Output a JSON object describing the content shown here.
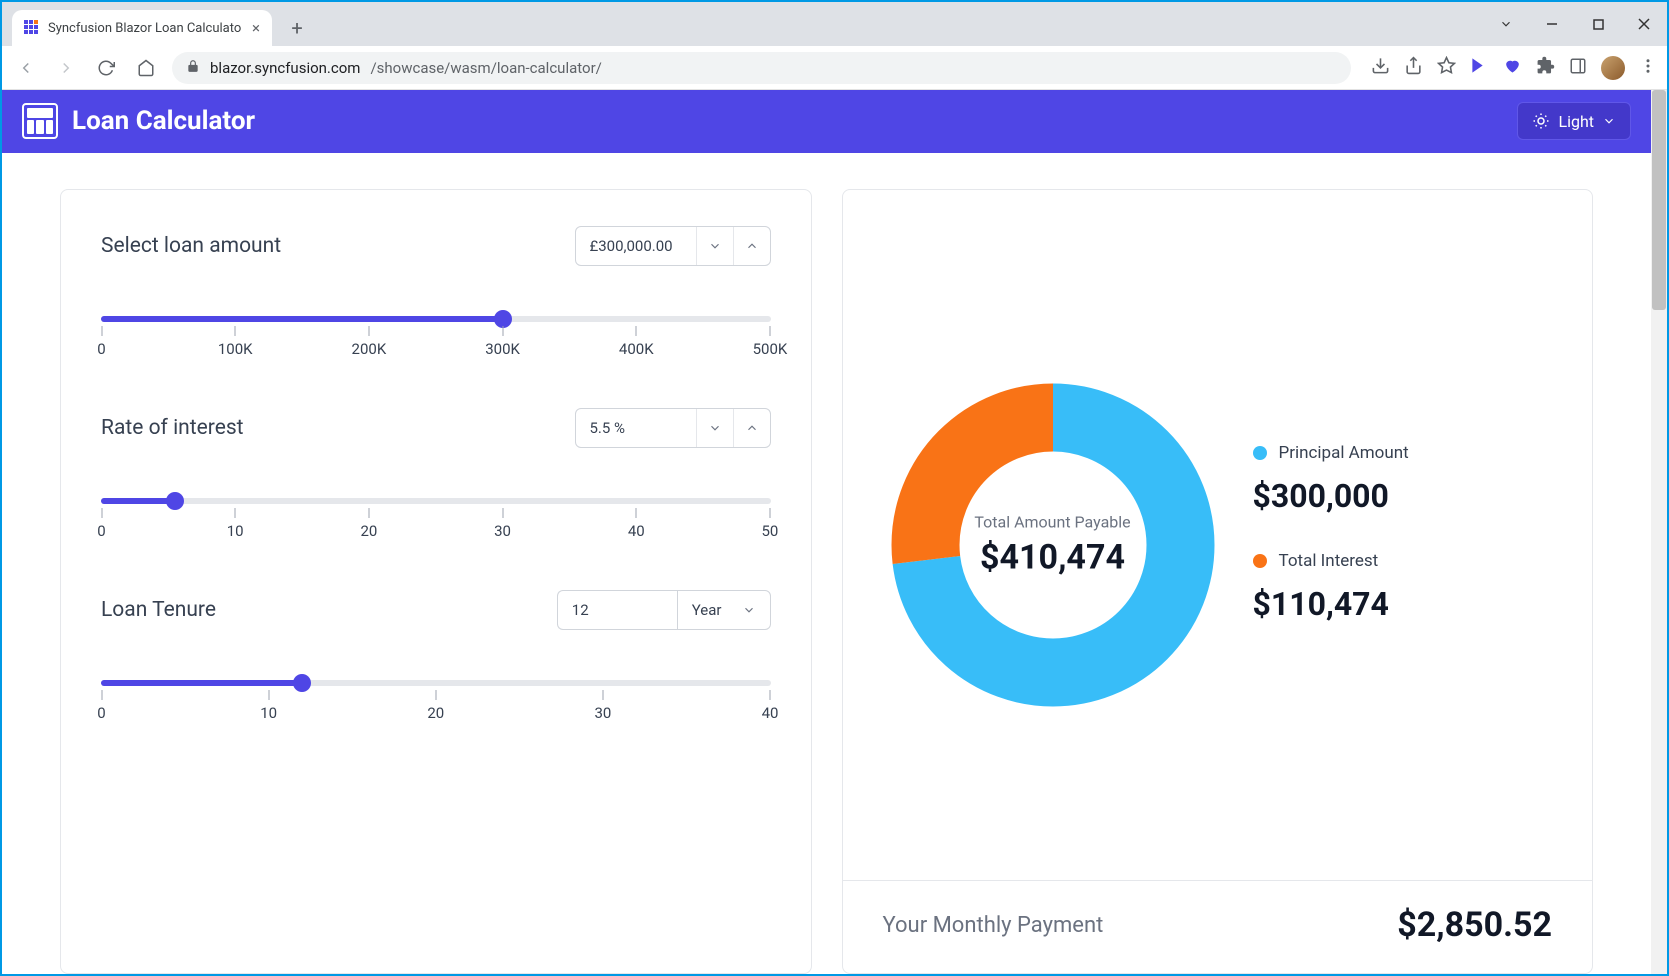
{
  "browser": {
    "tab_title": "Syncfusion Blazor Loan Calculato",
    "url_host": "blazor.syncfusion.com",
    "url_path": "/showcase/wasm/loan-calculator/"
  },
  "header": {
    "title": "Loan Calculator",
    "theme_label": "Light"
  },
  "inputs": {
    "amount": {
      "label": "Select loan amount",
      "value": "£300,000.00",
      "percent": 60,
      "ticks": [
        "0",
        "100K",
        "200K",
        "300K",
        "400K",
        "500K"
      ]
    },
    "rate": {
      "label": "Rate of interest",
      "value": "5.5  %",
      "percent": 11,
      "ticks": [
        "0",
        "10",
        "20",
        "30",
        "40",
        "50"
      ]
    },
    "tenure": {
      "label": "Loan Tenure",
      "value": "12",
      "unit": "Year",
      "percent": 30,
      "ticks": [
        "0",
        "10",
        "20",
        "30",
        "40"
      ]
    }
  },
  "results": {
    "center_label": "Total Amount Payable",
    "center_value": "$410,474",
    "principal_label": "Principal Amount",
    "principal_value": "$300,000",
    "interest_label": "Total Interest",
    "interest_value": "$110,474",
    "monthly_label": "Your Monthly Payment",
    "monthly_value": "$2,850.52"
  },
  "colors": {
    "principal": "#38bdf8",
    "interest": "#f97316",
    "accent": "#4f46e5"
  },
  "chart_data": {
    "type": "pie",
    "title": "Total Amount Payable",
    "series": [
      {
        "name": "Principal Amount",
        "value": 300000,
        "color": "#38bdf8"
      },
      {
        "name": "Total Interest",
        "value": 110474,
        "color": "#f97316"
      }
    ],
    "total": 410474
  }
}
